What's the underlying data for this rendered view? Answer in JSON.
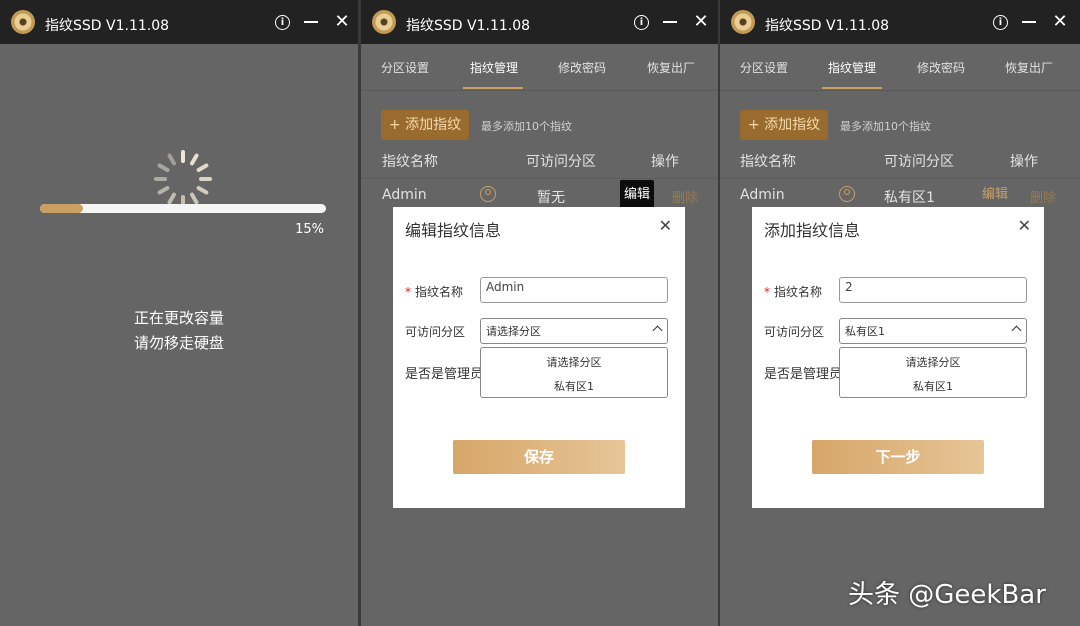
{
  "app_title": "指纹SSD V1.11.08",
  "loading_window": {
    "progress_percent": 15,
    "progress_label": "15%",
    "status_line1": "正在更改容量",
    "status_line2": "请勿移走硬盘"
  },
  "tabs": [
    "分区设置",
    "指纹管理",
    "修改密码",
    "恢复出厂"
  ],
  "active_tab": "指纹管理",
  "add_button_label": "添加指纹",
  "add_hint": "最多添加10个指纹",
  "table_headers": {
    "name": "指纹名称",
    "partition": "可访问分区",
    "actions": "操作"
  },
  "edit_window": {
    "row": {
      "name": "Admin",
      "partition": "暂无",
      "edit": "编辑",
      "delete": "删除"
    },
    "modal": {
      "title": "编辑指纹信息",
      "name_label": "指纹名称",
      "name_value": "Admin",
      "partition_label": "可访问分区",
      "partition_value": "请选择分区",
      "admin_label": "是否是管理员",
      "options": [
        "请选择分区",
        "私有区1"
      ],
      "button": "保存"
    }
  },
  "add_window": {
    "row": {
      "name": "Admin",
      "partition": "私有区1",
      "edit": "编辑",
      "delete": "删除"
    },
    "modal": {
      "title": "添加指纹信息",
      "name_label": "指纹名称",
      "name_value": "2",
      "partition_label": "可访问分区",
      "partition_value": "私有区1",
      "admin_label": "是否是管理员",
      "options": [
        "请选择分区",
        "私有区1"
      ],
      "button": "下一步"
    }
  },
  "watermark": "头条 @GeekBar",
  "colors": {
    "accent": "#c9a062",
    "titlebar": "#222222",
    "panel": "#656565"
  }
}
